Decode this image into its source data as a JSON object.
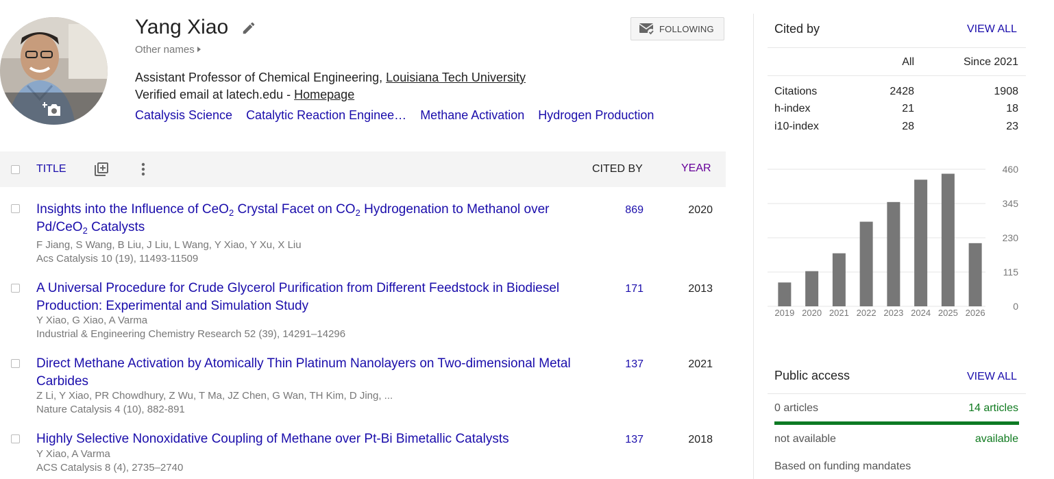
{
  "profile": {
    "name": "Yang Xiao",
    "other_names": "Other names",
    "affiliation_prefix": "Assistant Professor of Chemical Engineering, ",
    "affiliation_link": "Louisiana Tech University",
    "email_prefix": "Verified email at latech.edu - ",
    "homepage_link": "Homepage",
    "interests": [
      "Catalysis Science",
      "Catalytic Reaction Enginee…",
      "Methane Activation",
      "Hydrogen Production"
    ],
    "follow_label": "FOLLOWING"
  },
  "table": {
    "title_header": "TITLE",
    "cited_by_header": "CITED BY",
    "year_header": "YEAR"
  },
  "articles": [
    {
      "title_parts": [
        "Insights into the Influence of CeO",
        "2",
        " Crystal Facet on CO",
        "2",
        " Hydrogenation to Methanol over Pd/CeO",
        "2",
        " Catalysts"
      ],
      "authors": "F Jiang, S Wang, B Liu, J Liu, L Wang, Y Xiao, Y Xu, X Liu",
      "venue": "Acs Catalysis 10 (19), 11493-11509",
      "cited_by": "869",
      "year": "2020"
    },
    {
      "title": "A Universal Procedure for Crude Glycerol Purification from Different Feedstock in Biodiesel Production: Experimental and Simulation Study",
      "authors": "Y Xiao, G Xiao, A Varma",
      "venue": "Industrial & Engineering Chemistry Research 52 (39), 14291–14296",
      "cited_by": "171",
      "year": "2013"
    },
    {
      "title": "Direct Methane Activation by Atomically Thin Platinum Nanolayers on Two-dimensional Metal Carbides",
      "authors": "Z Li, Y Xiao, PR Chowdhury, Z Wu, T Ma, JZ Chen, G Wan, TH Kim, D Jing, ...",
      "venue": "Nature Catalysis 4 (10), 882-891",
      "cited_by": "137",
      "year": "2021"
    },
    {
      "title": "Highly Selective Nonoxidative Coupling of Methane over Pt-Bi Bimetallic Catalysts",
      "authors": "Y Xiao, A Varma",
      "venue": "ACS Catalysis 8 (4), 2735–2740",
      "cited_by": "137",
      "year": "2018"
    }
  ],
  "cited_by": {
    "title": "Cited by",
    "view_all": "VIEW ALL",
    "col_all": "All",
    "col_since": "Since 2021",
    "rows": [
      {
        "label": "Citations",
        "all": "2428",
        "since": "1908"
      },
      {
        "label": "h-index",
        "all": "21",
        "since": "18"
      },
      {
        "label": "i10-index",
        "all": "28",
        "since": "23"
      }
    ]
  },
  "chart_data": {
    "type": "bar",
    "categories": [
      "2019",
      "2020",
      "2021",
      "2022",
      "2023",
      "2024",
      "2025",
      "2026"
    ],
    "values": [
      80,
      118,
      178,
      284,
      350,
      425,
      445,
      212
    ],
    "ylim": [
      0,
      460
    ],
    "yticks": [
      "460",
      "345",
      "230",
      "115",
      "0"
    ],
    "ytick_values": [
      460,
      345,
      230,
      115,
      0
    ],
    "bar_color": "#777777",
    "grid": true
  },
  "public_access": {
    "title": "Public access",
    "view_all": "VIEW ALL",
    "unavailable_count": "0 articles",
    "available_count": "14 articles",
    "not_available_label": "not available",
    "available_label": "available",
    "footer": "Based on funding mandates",
    "available_fraction": 1.0
  },
  "colors": {
    "link": "#1a0dab",
    "accent_green": "#0d7a24",
    "year_header": "#660099"
  }
}
